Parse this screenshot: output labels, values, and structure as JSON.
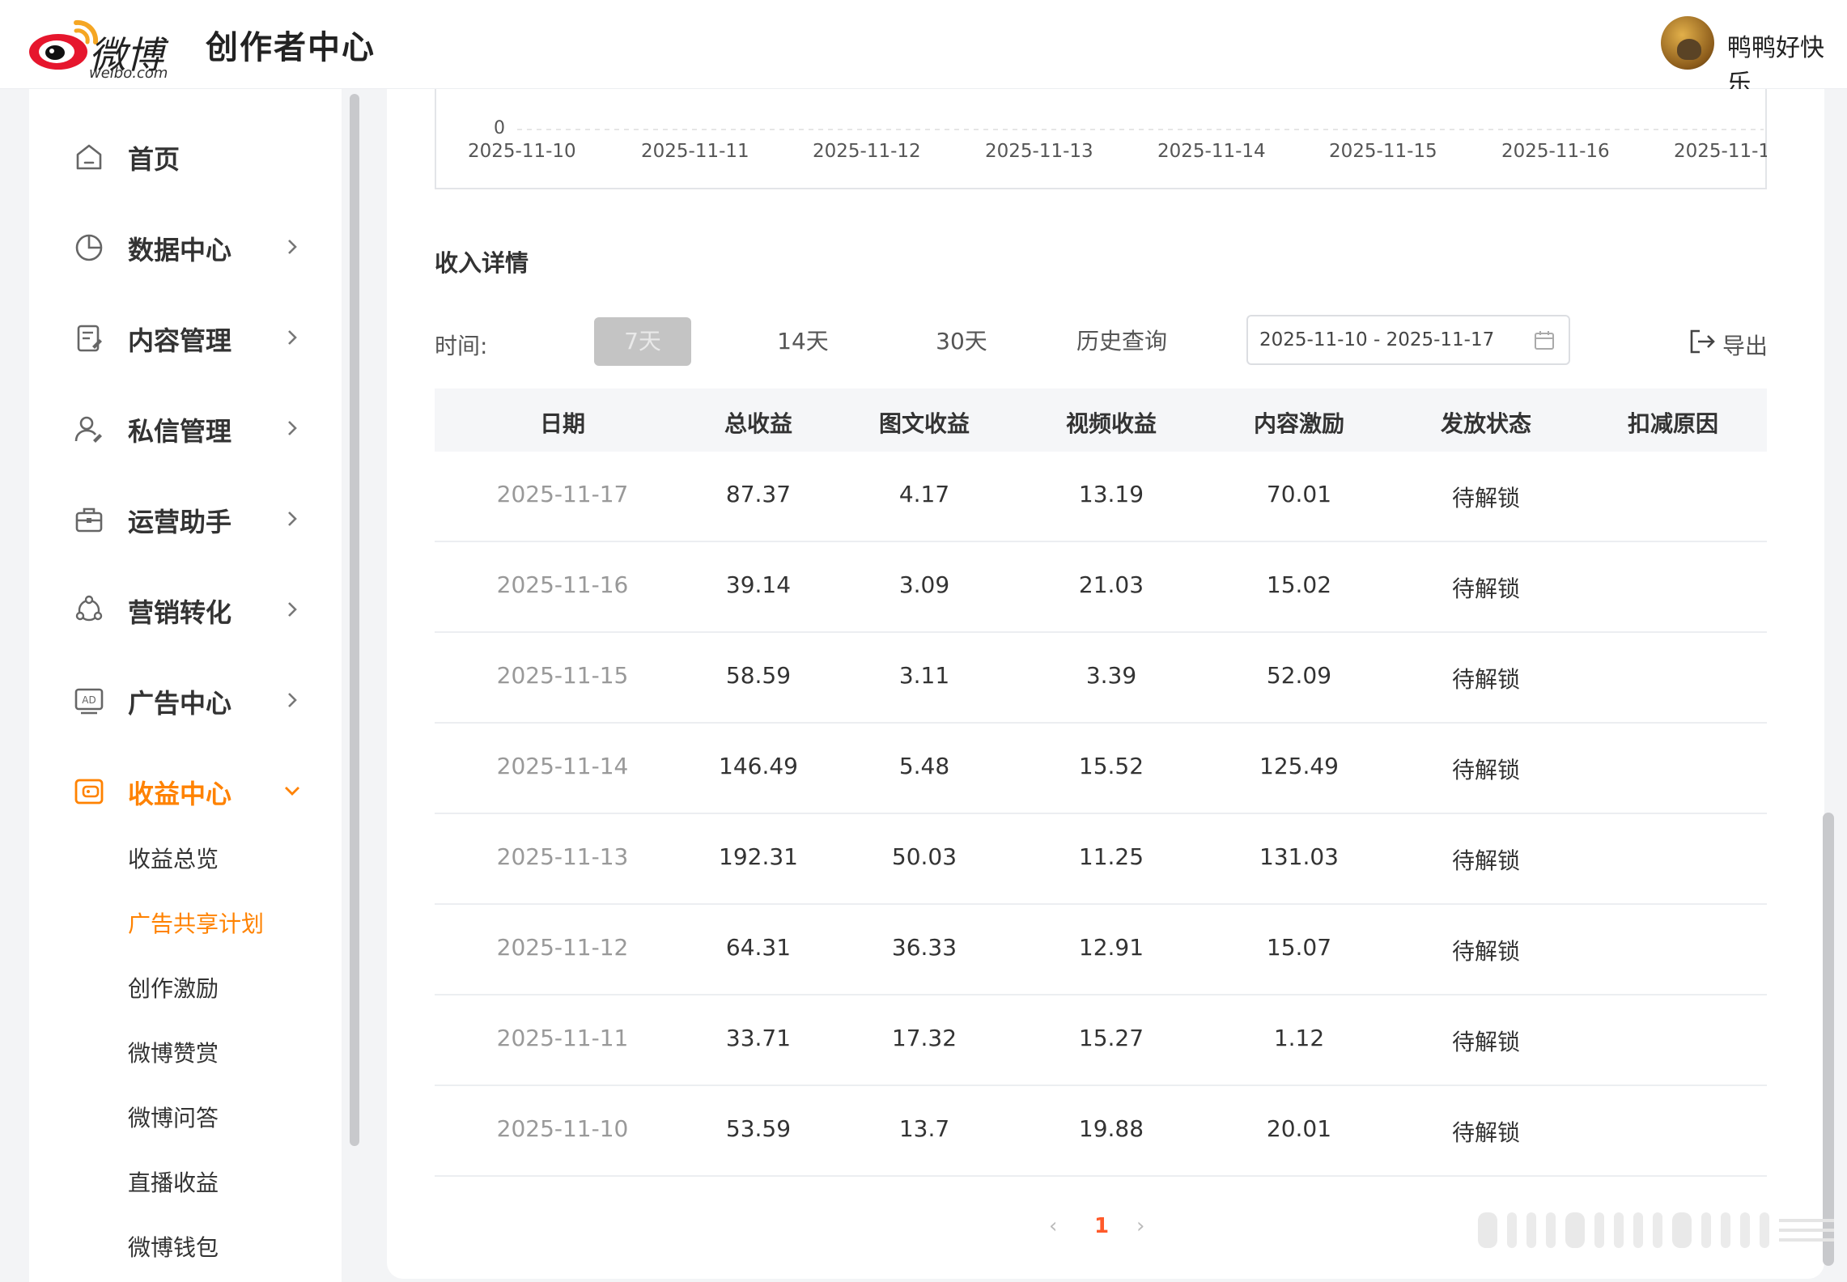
{
  "header": {
    "logo_text": "微博",
    "logo_domain": "weibo.com",
    "title": "创作者中心",
    "username": "鸭鸭好快乐"
  },
  "sidebar": {
    "items": [
      {
        "label": "首页",
        "icon": "home-icon"
      },
      {
        "label": "数据中心",
        "icon": "pie-chart-icon"
      },
      {
        "label": "内容管理",
        "icon": "document-edit-icon"
      },
      {
        "label": "私信管理",
        "icon": "user-message-icon"
      },
      {
        "label": "运营助手",
        "icon": "briefcase-icon"
      },
      {
        "label": "营销转化",
        "icon": "share-nodes-icon"
      },
      {
        "label": "广告中心",
        "icon": "ad-icon"
      },
      {
        "label": "收益中心",
        "icon": "wallet-icon"
      }
    ],
    "sub_items": [
      {
        "label": "收益总览"
      },
      {
        "label": "广告共享计划"
      },
      {
        "label": "创作激励"
      },
      {
        "label": "微博赞赏"
      },
      {
        "label": "微博问答"
      },
      {
        "label": "直播收益"
      },
      {
        "label": "微博钱包"
      }
    ],
    "active_color": "#ff8200"
  },
  "chart": {
    "zero_label": "0",
    "x_ticks": [
      "2025-11-10",
      "2025-11-11",
      "2025-11-12",
      "2025-11-13",
      "2025-11-14",
      "2025-11-15",
      "2025-11-16",
      "2025-11-1"
    ]
  },
  "income": {
    "section_title": "收入详情",
    "time_label": "时间:",
    "ranges": [
      "7天",
      "14天",
      "30天",
      "历史查询"
    ],
    "date_range": "2025-11-10 - 2025-11-17",
    "export_label": "导出",
    "columns": [
      "日期",
      "总收益",
      "图文收益",
      "视频收益",
      "内容激励",
      "发放状态",
      "扣减原因"
    ],
    "rows": [
      [
        "2025-11-17",
        "87.37",
        "4.17",
        "13.19",
        "70.01",
        "待解锁",
        ""
      ],
      [
        "2025-11-16",
        "39.14",
        "3.09",
        "21.03",
        "15.02",
        "待解锁",
        ""
      ],
      [
        "2025-11-15",
        "58.59",
        "3.11",
        "3.39",
        "52.09",
        "待解锁",
        ""
      ],
      [
        "2025-11-14",
        "146.49",
        "5.48",
        "15.52",
        "125.49",
        "待解锁",
        ""
      ],
      [
        "2025-11-13",
        "192.31",
        "50.03",
        "11.25",
        "131.03",
        "待解锁",
        ""
      ],
      [
        "2025-11-12",
        "64.31",
        "36.33",
        "12.91",
        "15.07",
        "待解锁",
        ""
      ],
      [
        "2025-11-11",
        "33.71",
        "17.32",
        "15.27",
        "1.12",
        "待解锁",
        ""
      ],
      [
        "2025-11-10",
        "53.59",
        "13.7",
        "19.88",
        "20.01",
        "待解锁",
        ""
      ]
    ]
  },
  "pagination": {
    "prev": "‹",
    "current": "1",
    "next": "›"
  }
}
